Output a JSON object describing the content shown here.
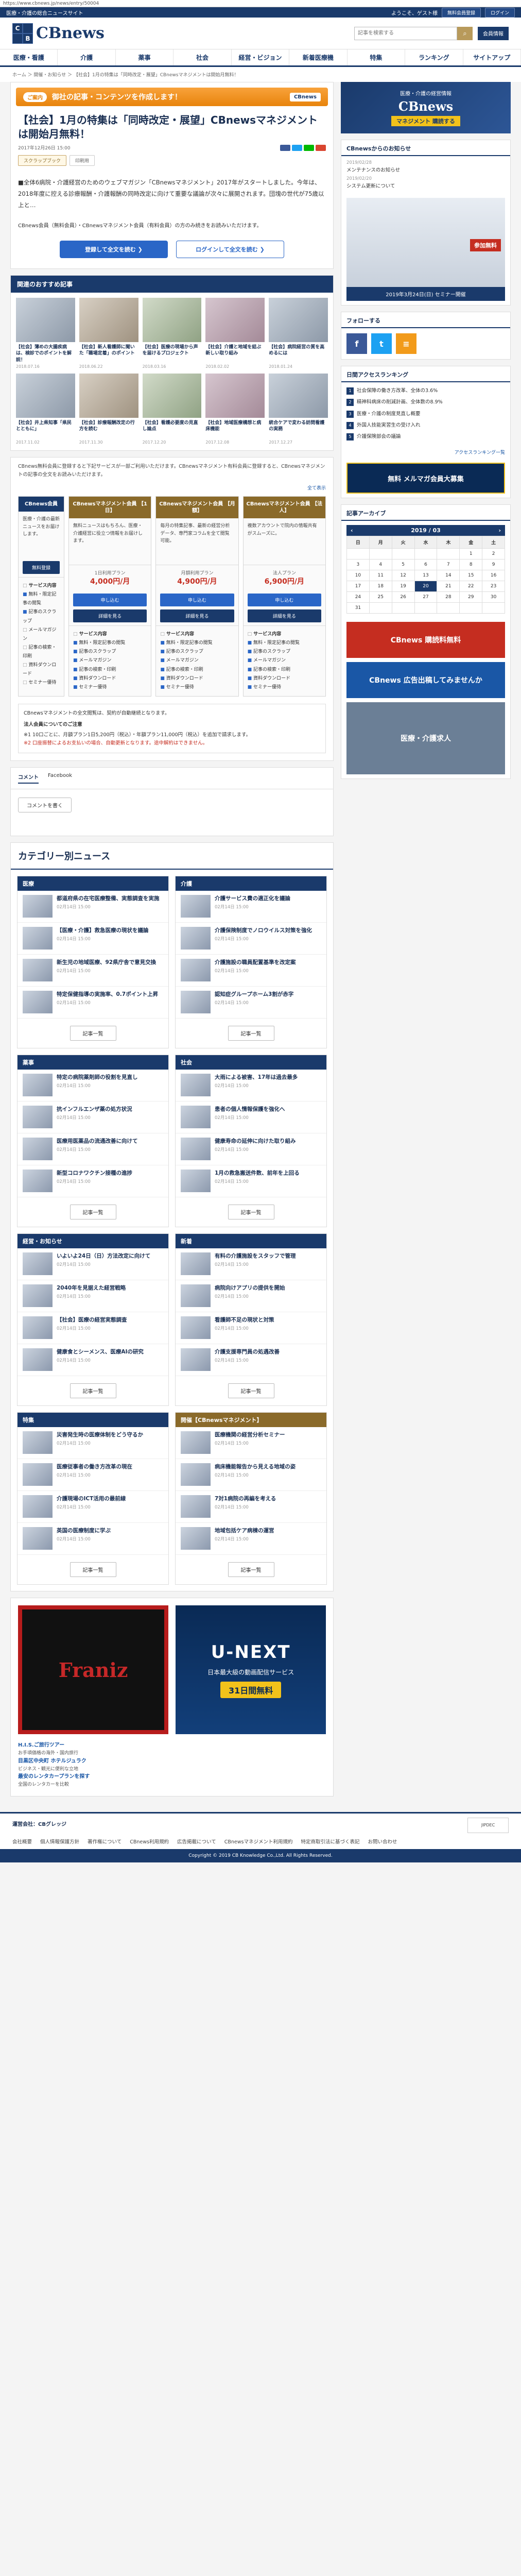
{
  "browser": {
    "url": "https://www.cbnews.jp/news/entry/50004"
  },
  "topbar": {
    "left": "医療・介護の総合ニュースサイト",
    "welcome": "ようこそ、ゲスト様",
    "register_label": "無料会員登録",
    "login_label": "ログイン"
  },
  "header": {
    "logo_c": "C",
    "logo_b": "B",
    "logo_text": "CBnews",
    "search_placeholder": "記事を検索する",
    "search_icon": "search-icon",
    "members_label": "会員情報"
  },
  "nav": [
    "医療・看護",
    "介護",
    "薬事",
    "社会",
    "経営・ビジョン",
    "新着医療機",
    "特集",
    "ランキング",
    "サイトアップ"
  ],
  "breadcrumb": "ホーム ＞ 開催・お知らせ ＞ 【社会】1月の特集は「同時改定・展望」CBnewsマネジメントは開始月無料！",
  "article": {
    "banner_pill": "ご案内",
    "banner_text": "御社の記事・コンテンツを作成します！",
    "banner_mark": "CBnews",
    "title": "【社会】1月の特集は「同時改定・展望」CBnewsマネジメントは開始月無料！",
    "date": "2017年12月26日 15:00",
    "tag1": "スクラップブック",
    "tag2": "印刷用",
    "body": "■全体6病院・介護経営のためのウェブマガジン「CBnewsマネジメント」2017年がスタートしました。今年は、2018年度に控える診療報酬・介護報酬の同時改定に向けて重要な議論が次々に展開されます。団塊の世代が75歳以上と…",
    "notice": "CBnews会員（無料会員）・CBnewsマネジメント会員（有料会員）の方のみ続きをお読みいただけます。",
    "cta_register": "登録して全文を読む ❯",
    "cta_login": "ログインして全文を読む ❯"
  },
  "related": {
    "heading": "関連のおすすめ記事",
    "items": [
      {
        "title": "【社会】薄めの大腸疾病は、検診でのポイントを解説！",
        "date": "2018.07.16"
      },
      {
        "title": "【社会】新人看護師に聞いた「職場定着」のポイント",
        "date": "2018.06.22"
      },
      {
        "title": "【社会】医療の現場から声を届けるプロジェクト",
        "date": "2018.03.16"
      },
      {
        "title": "【社会】介護と地域を結ぶ新しい取り組み",
        "date": "2018.02.02"
      },
      {
        "title": "【社会】病院経営の質を高めるには",
        "date": "2018.01.24"
      },
      {
        "title": "【社会】井上県知事「県民とともに」",
        "date": "2017.11.02"
      },
      {
        "title": "【社会】診療報酬改定の行方を読む",
        "date": "2017.11.30"
      },
      {
        "title": "【社会】看護必要度の見直し論点",
        "date": "2017.12.20"
      },
      {
        "title": "【社会】地域医療構想と病床機能",
        "date": "2017.12.08"
      },
      {
        "title": "統合ケアで変わる訪問看護の実務",
        "date": "2017.12.27"
      }
    ]
  },
  "pricing": {
    "note": "CBnews無料会員に登録すると下記サービスが一部ご利用いただけます。CBnewsマネジメント有料会員に登録すると、CBnewsマネジメントの記事の全文をお読みいただけます。",
    "link_all": "全て表示",
    "col_label": "CBnews会員",
    "col_label_desc": "医療・介護の最新ニュースをお届けします。",
    "plans": [
      {
        "name": "CBnewsマネジメント会員 【1日】",
        "desc": "無料ニュースはもちろん、医療・介護経営に役立つ情報をお届けします。",
        "price_label": "1日利用プラン",
        "price": "4,000円/月",
        "btn1": "申し込む",
        "btn2": "詳細を見る"
      },
      {
        "name": "CBnewsマネジメント会員 【月額】",
        "desc": "毎月の特集記事、最新の経営分析データ、専門家コラムを全て閲覧可能。",
        "price_label": "月額利用プラン",
        "price": "4,900円/月",
        "btn1": "申し込む",
        "btn2": "詳細を見る"
      },
      {
        "name": "CBnewsマネジメント会員 【法人】",
        "desc": "複数アカウントで院内の情報共有がスムーズに。",
        "price_label": "法人プラン",
        "price": "6,900円/月",
        "btn1": "申し込む",
        "btn2": "詳細を見る"
      }
    ],
    "features_head": "サービス内容",
    "features": [
      "無料・限定記事の閲覧",
      "記事のスクラップ",
      "メールマガジン",
      "記事の検索・印刷",
      "資料ダウンロード",
      "セミナー優待"
    ],
    "free_register": "無料登録"
  },
  "law": {
    "note": "CBnewsマネジメントの全文閲覧は、契約が自動継続となります。",
    "title": "法人会員についてのご注意",
    "text1": "※1 10口ごとに、月額プラン1日5,200円（税込）・年額プラン11,000円（税込）を追加で請求します。",
    "text2": "※2 口座振替によるお支払いの場合、自動更新となります。途中解約はできません。"
  },
  "comments": {
    "tab1": "コメント",
    "tab2": "Facebook",
    "button": "コメントを書く"
  },
  "categories": {
    "heading": "カテゴリー別ニュース",
    "more": "記事一覧",
    "boxes": [
      {
        "name": "医療",
        "items": [
          {
            "t": "都道府県の在宅医療整備、実態調査を実施",
            "d": "02月14日 15:00"
          },
          {
            "t": "【医療・介護】救急医療の現状を議論",
            "d": "02月14日 15:00"
          },
          {
            "t": "新生児の地域医療、92県庁舎で意見交換",
            "d": "02月14日 15:00"
          },
          {
            "t": "特定保健指導の実施率、0.7ポイント上昇",
            "d": "02月14日 15:00"
          }
        ]
      },
      {
        "name": "介護",
        "items": [
          {
            "t": "介護サービス費の適正化を議論",
            "d": "02月14日 15:00"
          },
          {
            "t": "介護保険制度でノロウイルス対策を強化",
            "d": "02月14日 15:00"
          },
          {
            "t": "介護施設の職員配置基準を改定案",
            "d": "02月14日 15:00"
          },
          {
            "t": "認知症グループホーム3割が赤字",
            "d": "02月14日 15:00"
          }
        ]
      },
      {
        "name": "薬事",
        "items": [
          {
            "t": "特定の病院薬剤師の役割を見直し",
            "d": "02月14日 15:00"
          },
          {
            "t": "抗インフルエンザ薬の処方状況",
            "d": "02月14日 15:00"
          },
          {
            "t": "医療用医薬品の流通改善に向けて",
            "d": "02月14日 15:00"
          },
          {
            "t": "新型コロナワクチン接種の進捗",
            "d": "02月14日 15:00"
          }
        ]
      },
      {
        "name": "社会",
        "items": [
          {
            "t": "大雨による被害、17年は過去最多",
            "d": "02月14日 15:00"
          },
          {
            "t": "患者の個人情報保護を強化へ",
            "d": "02月14日 15:00"
          },
          {
            "t": "健康寿命の延伸に向けた取り組み",
            "d": "02月14日 15:00"
          },
          {
            "t": "1月の救急搬送件数、前年を上回る",
            "d": "02月14日 15:00"
          }
        ]
      },
      {
        "name": "経営・お知らせ",
        "items": [
          {
            "t": "いよいよ24日（日）方法改定に向けて",
            "d": "02月14日 15:00"
          },
          {
            "t": "2040年を見据えた経営戦略",
            "d": "02月14日 15:00"
          },
          {
            "t": "【社会】医療の経営実態調査",
            "d": "02月14日 15:00"
          },
          {
            "t": "健康食とシーメンス、医療AIの研究",
            "d": "02月14日 15:00"
          }
        ]
      },
      {
        "name": "新着",
        "items": [
          {
            "t": "有料の介護施設をスタッフで管理",
            "d": "02月14日 15:00"
          },
          {
            "t": "病院向けアプリの提供を開始",
            "d": "02月14日 15:00"
          },
          {
            "t": "看護師不足の現状と対策",
            "d": "02月14日 15:00"
          },
          {
            "t": "介護支援専門員の処遇改善",
            "d": "02月14日 15:00"
          }
        ]
      },
      {
        "name": "特集",
        "items": [
          {
            "t": "災害発生時の医療体制をどう守るか",
            "d": "02月14日 15:00"
          },
          {
            "t": "医療従事者の働き方改革の現在",
            "d": "02月14日 15:00"
          },
          {
            "t": "介護現場のICT活用の最前線",
            "d": "02月14日 15:00"
          },
          {
            "t": "英国の医療制度に学ぶ",
            "d": "02月14日 15:00"
          }
        ]
      },
      {
        "name": "開催【CBnewsマネジメント】",
        "items": [
          {
            "t": "医療機関の経営分析セミナー",
            "d": "02月14日 15:00"
          },
          {
            "t": "病床機能報告から見える地域の姿",
            "d": "02月14日 15:00"
          },
          {
            "t": "7対1病院の再編を考える",
            "d": "02月14日 15:00"
          },
          {
            "t": "地域包括ケア病棟の運営",
            "d": "02月14日 15:00"
          }
        ]
      }
    ]
  },
  "ads": {
    "left": "Franiz",
    "right_logo": "U-NEXT",
    "right_text": "日本最大級の動画配信サービス",
    "right_free": "31日間無料",
    "texts": [
      {
        "t": "H.I.S.ご旅行ツアー",
        "d": "お手頃価格の海外・国内旅行"
      },
      {
        "t": "目黒区中央町 ホテルジュラク",
        "d": "ビジネス・観光に便利な立地"
      },
      {
        "t": "最安のレンタカープランを探す",
        "d": "全国のレンタカーを比較"
      }
    ]
  },
  "side": {
    "top_banner": {
      "l1": "医療・介護の経営情報",
      "l2": "CBnews",
      "l3": "マネジメント 購読する"
    },
    "news_head": "CBnewsからのお知らせ",
    "news": [
      {
        "d": "2019/02/28",
        "t": "メンテナンスのお知らせ"
      },
      {
        "d": "2019/02/20",
        "t": "システム更新について"
      }
    ],
    "seminar_caption": "2019年3月24日(日) セミナー開催",
    "seminar_tag": "参加無料",
    "follow_head": "フォローする",
    "ranking_head": "日間アクセスランキング",
    "ranking": [
      "社会保障の働き方改革、全体の3.6%",
      "精神科病床の削減計画、全体数の8.9%",
      "医療・介護の制度見直し概要",
      "外国人技能実習生の受け入れ",
      "介護保険部会の議論"
    ],
    "ranking_more": "アクセスランキング一覧",
    "mail_banner": "無料 メルマガ会員大募集",
    "archive_head": "記事アーカイブ",
    "calendar_title": "2019 / 03",
    "weekdays": [
      "日",
      "月",
      "火",
      "水",
      "木",
      "金",
      "土"
    ],
    "days": [
      "",
      "",
      "",
      "",
      "",
      "1",
      "2",
      "3",
      "4",
      "5",
      "6",
      "7",
      "8",
      "9",
      "10",
      "11",
      "12",
      "13",
      "14",
      "15",
      "16",
      "17",
      "18",
      "19",
      "20",
      "21",
      "22",
      "23",
      "24",
      "25",
      "26",
      "27",
      "28",
      "29",
      "30",
      "31",
      "",
      "",
      "",
      "",
      "",
      ""
    ],
    "today": "20",
    "ad1": "CBnews 購読料無料",
    "ad2": "CBnews 広告出稿してみませんか",
    "ad3": "医療・介護求人"
  },
  "footer": {
    "company": "運営会社：CBグレッジ",
    "links": [
      "会社概要",
      "個人情報保護方針",
      "著作権について",
      "CBnews利用規約",
      "広告掲載について",
      "CBnewsマネジメント利用規約",
      "特定商取引法に基づく表記",
      "お問い合わせ"
    ],
    "badge": "JIPDEC",
    "copy": "Copyright © 2019 CB Knowledge Co.,Ltd. All Rights Reserved."
  }
}
